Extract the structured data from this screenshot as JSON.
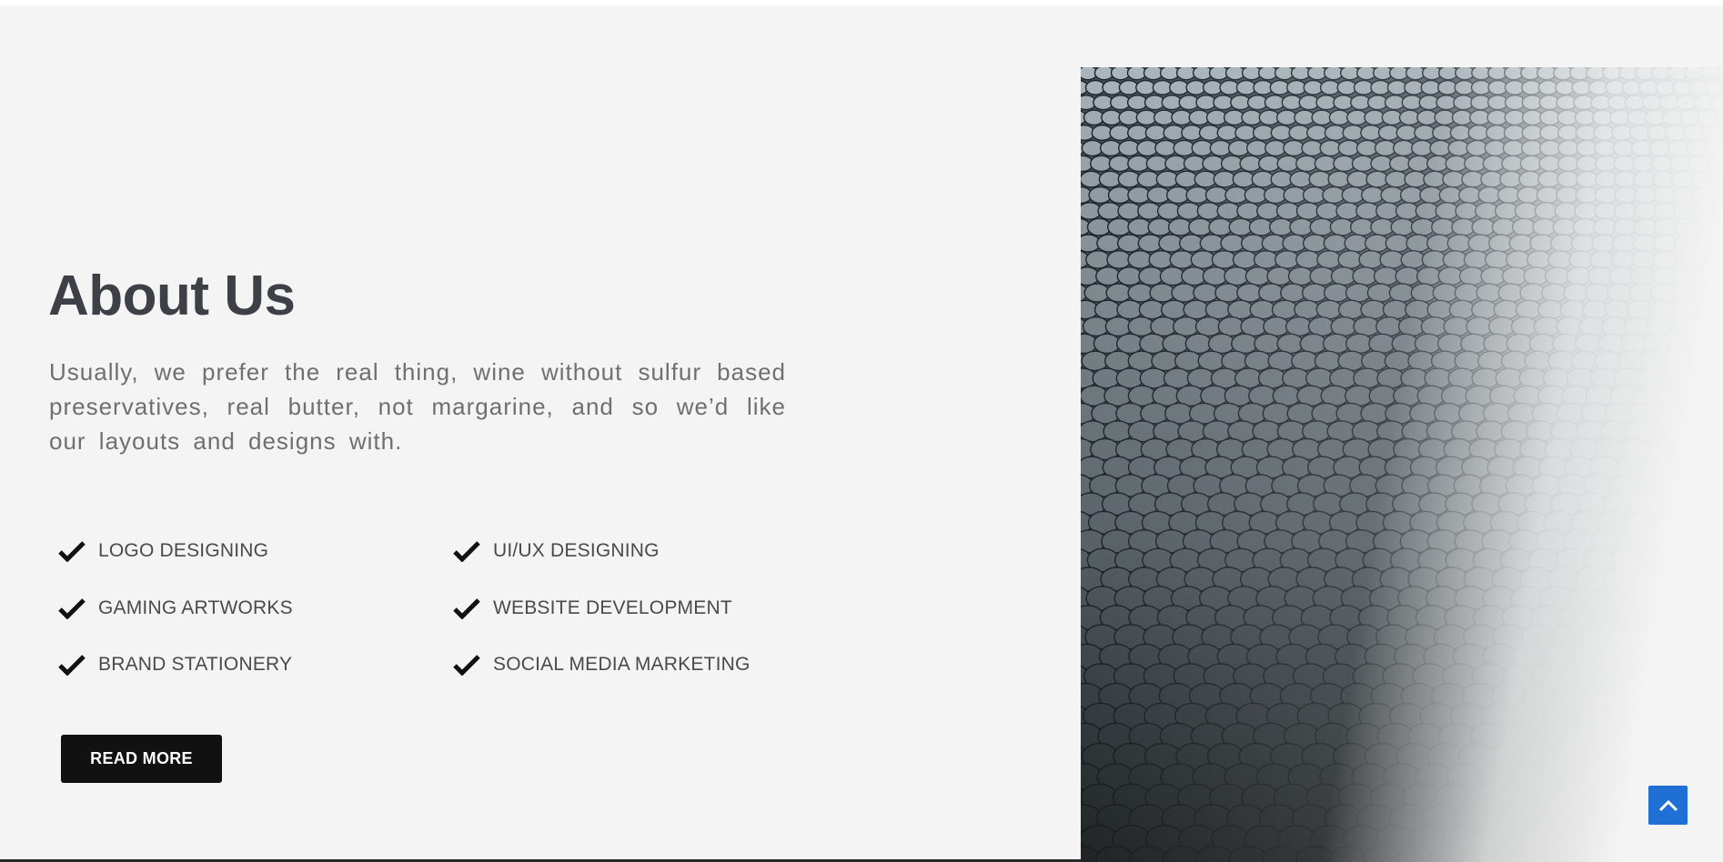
{
  "about": {
    "title": "About Us",
    "description": "Usually, we prefer the real thing, wine without sulfur based preservatives, real butter, not margarine, and so we’d like our layouts and designs with."
  },
  "services": {
    "items": [
      {
        "label": "LOGO DESIGNING",
        "icon": "check-icon"
      },
      {
        "label": "UI/UX DESIGNING",
        "icon": "check-icon"
      },
      {
        "label": "GAMING ARTWORKS",
        "icon": "check-icon"
      },
      {
        "label": "WEBSITE DEVELOPMENT",
        "icon": "check-icon"
      },
      {
        "label": "BRAND STATIONERY",
        "icon": "check-icon"
      },
      {
        "label": "SOCIAL MEDIA MARKETING",
        "icon": "check-icon"
      }
    ]
  },
  "cta": {
    "read_more_label": "READ MORE"
  },
  "scroll_top": {
    "icon": "chevron-up-icon"
  },
  "image": {
    "subject": "building-facade-photo"
  },
  "colors": {
    "section_background": "#f4f4f4",
    "heading": "#3d4046",
    "body_text": "#6f6f6f",
    "button_background": "#111111",
    "scroll_button": "#1f6fd4"
  }
}
